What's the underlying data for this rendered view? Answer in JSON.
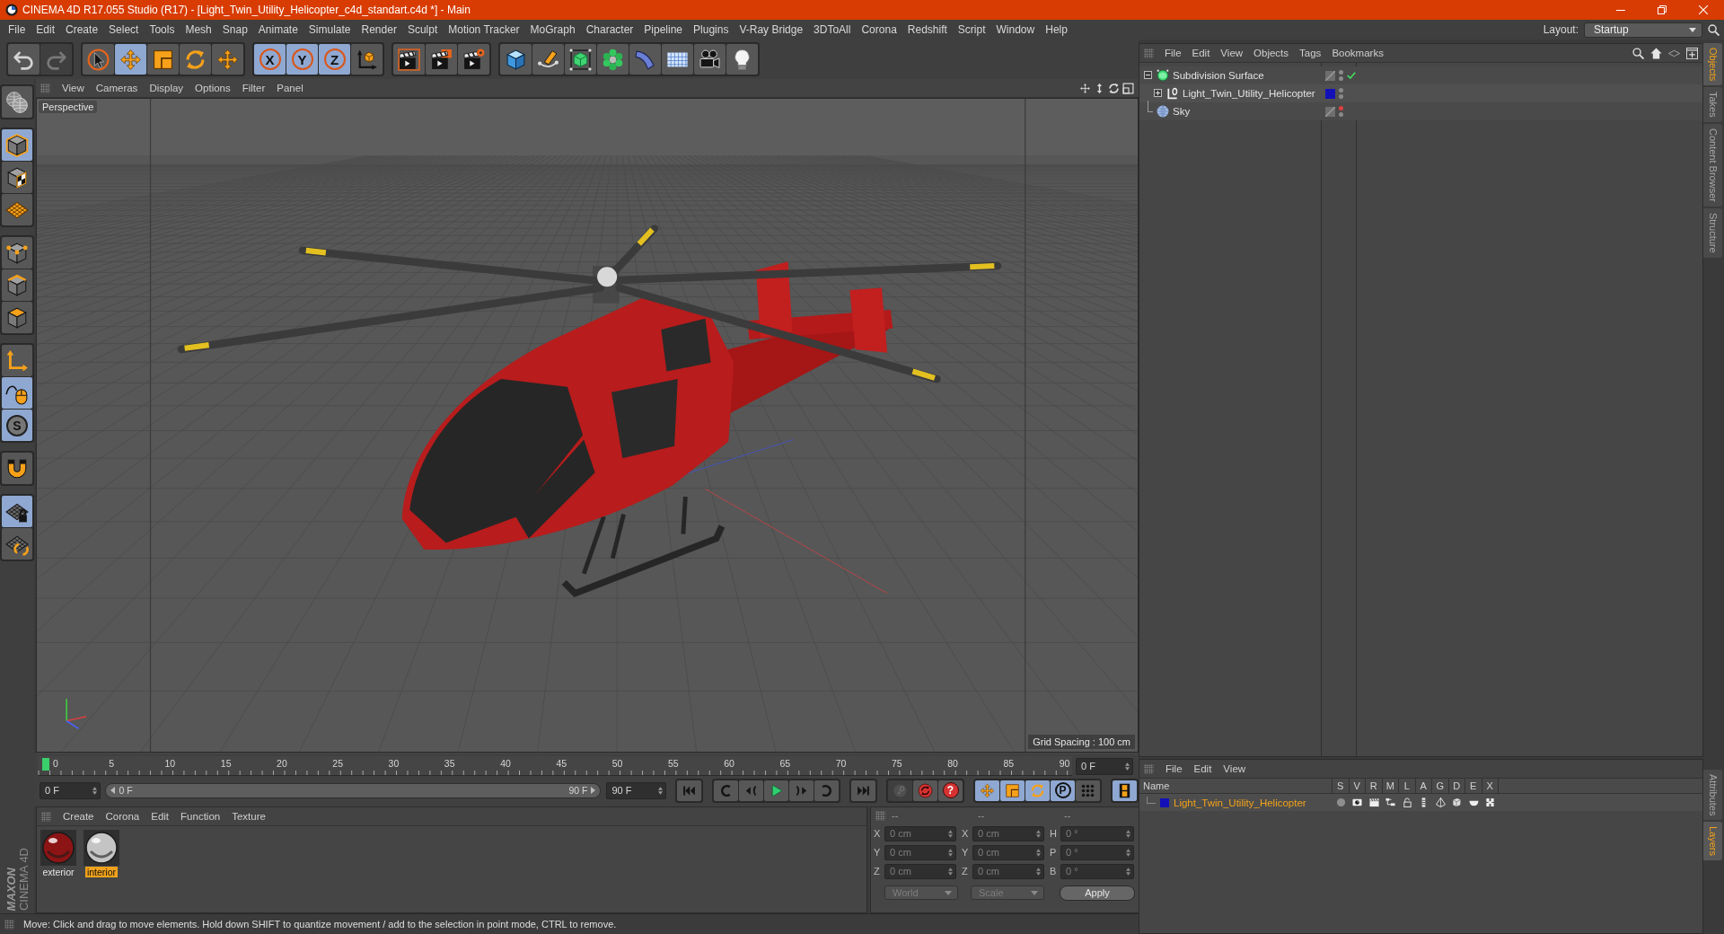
{
  "window": {
    "title": "CINEMA 4D R17.055 Studio (R17) - [Light_Twin_Utility_Helicopter_c4d_standart.c4d *] - Main"
  },
  "menu": [
    "File",
    "Edit",
    "Create",
    "Select",
    "Tools",
    "Mesh",
    "Snap",
    "Animate",
    "Simulate",
    "Render",
    "Sculpt",
    "Motion Tracker",
    "MoGraph",
    "Character",
    "Pipeline",
    "Plugins",
    "V-Ray Bridge",
    "3DToAll",
    "Corona",
    "Redshift",
    "Script",
    "Window",
    "Help"
  ],
  "layout": {
    "label": "Layout:",
    "value": "Startup"
  },
  "toolbar": [
    [
      {
        "kind": "undo",
        "selected": false,
        "disabled": false
      },
      {
        "kind": "redo",
        "selected": false,
        "disabled": true
      }
    ],
    [
      {
        "kind": "live_selection",
        "selected": false,
        "disabled": false
      },
      {
        "kind": "move",
        "selected": true,
        "disabled": false
      },
      {
        "kind": "scale",
        "selected": false,
        "disabled": false
      },
      {
        "kind": "rotate",
        "selected": false,
        "disabled": false
      },
      {
        "kind": "move",
        "selected": false,
        "disabled": false
      }
    ],
    [
      {
        "kind": "axis_lock",
        "label": "X",
        "selected": true,
        "disabled": false
      },
      {
        "kind": "axis_lock",
        "label": "Y",
        "selected": true,
        "disabled": false
      },
      {
        "kind": "axis_lock",
        "label": "Z",
        "selected": true,
        "disabled": false
      },
      {
        "kind": "coord_system",
        "selected": false,
        "disabled": false
      }
    ],
    [
      {
        "kind": "render_view",
        "selected": false,
        "disabled": false
      },
      {
        "kind": "render_picture_viewer",
        "selected": false,
        "disabled": false
      },
      {
        "kind": "render_settings",
        "selected": false,
        "disabled": false
      }
    ],
    [
      {
        "kind": "cube",
        "selected": false,
        "disabled": false
      },
      {
        "kind": "pen",
        "selected": false,
        "disabled": false
      },
      {
        "kind": "subdivision",
        "selected": false,
        "disabled": false
      },
      {
        "kind": "cloner",
        "selected": false,
        "disabled": false
      },
      {
        "kind": "bend",
        "selected": false,
        "disabled": false
      },
      {
        "kind": "floor",
        "selected": false,
        "disabled": false
      },
      {
        "kind": "camera",
        "selected": false,
        "disabled": false
      },
      {
        "kind": "light",
        "selected": false,
        "disabled": false
      }
    ]
  ],
  "left_toolbar": [
    [
      {
        "kind": "make_editable",
        "selected": false
      }
    ],
    [
      {
        "kind": "model",
        "selected": true
      },
      {
        "kind": "texture",
        "selected": false
      },
      {
        "kind": "workplane",
        "selected": false
      }
    ],
    [
      {
        "kind": "points",
        "selected": false
      },
      {
        "kind": "edges",
        "selected": false
      },
      {
        "kind": "polygons",
        "selected": false
      }
    ],
    [
      {
        "kind": "axis",
        "selected": false
      },
      {
        "kind": "tweak",
        "selected": true
      },
      {
        "kind": "snap",
        "label": "S",
        "selected": true
      }
    ],
    [
      {
        "kind": "magnet",
        "selected": false
      }
    ],
    [
      {
        "kind": "workplane_lock",
        "selected": true
      },
      {
        "kind": "workplane_rotate",
        "selected": false
      }
    ]
  ],
  "logo": {
    "brand": "MAXON",
    "product": "CINEMA 4D"
  },
  "viewport": {
    "menu": [
      "View",
      "Cameras",
      "Display",
      "Options",
      "Filter",
      "Panel"
    ],
    "camera": "Perspective",
    "grid_spacing": "Grid Spacing : 100 cm"
  },
  "timeline": {
    "ticks": [
      "0",
      "5",
      "10",
      "15",
      "20",
      "25",
      "30",
      "35",
      "40",
      "45",
      "50",
      "55",
      "60",
      "65",
      "70",
      "75",
      "80",
      "85",
      "90"
    ],
    "playhead": {
      "level": 0
    },
    "current_frame": "0 F",
    "start_field": "0 F",
    "range": {
      "start": "0 F",
      "end": "90 F"
    },
    "end_field": "90 F",
    "transport": [
      [
        {
          "kind": "go_start",
          "selected": false,
          "disabled": false
        }
      ],
      [
        {
          "kind": "prev_key",
          "selected": false,
          "disabled": false
        },
        {
          "kind": "prev_frame",
          "selected": false,
          "disabled": false
        },
        {
          "kind": "play",
          "selected": false,
          "disabled": false
        },
        {
          "kind": "next_frame",
          "selected": false,
          "disabled": false
        },
        {
          "kind": "next_key",
          "selected": false,
          "disabled": false
        }
      ],
      [
        {
          "kind": "go_end",
          "selected": false,
          "disabled": false
        }
      ],
      [
        {
          "kind": "key",
          "selected": false,
          "disabled": true
        },
        {
          "kind": "autokey",
          "selected": false,
          "disabled": false
        },
        {
          "kind": "help",
          "label": "?",
          "selected": false,
          "disabled": false
        }
      ],
      [
        {
          "kind": "move",
          "selected": true,
          "disabled": false
        },
        {
          "kind": "scale",
          "selected": true,
          "disabled": false
        },
        {
          "kind": "rotate",
          "selected": true,
          "disabled": false
        },
        {
          "kind": "parameter",
          "label": "P",
          "selected": true,
          "disabled": false
        },
        {
          "kind": "point_level",
          "selected": false,
          "disabled": false
        }
      ],
      [
        {
          "kind": "timeline",
          "selected": true,
          "disabled": false
        }
      ]
    ]
  },
  "material_manager": {
    "menu": [
      "Create",
      "Corona",
      "Edit",
      "Function",
      "Texture"
    ],
    "materials": [
      {
        "name": "exterior",
        "selected": false,
        "color": "#8c1414"
      },
      {
        "name": "interior",
        "selected": true,
        "color": "#c4c4c4"
      }
    ]
  },
  "coordinates": {
    "disabled": true,
    "headers": [
      "--",
      "--",
      "--"
    ],
    "rows": [
      {
        "cells": [
          {
            "axis": "X",
            "value": "0 cm"
          },
          {
            "axis": "X",
            "value": "0 cm"
          },
          {
            "axis": "H",
            "value": "0 °"
          }
        ]
      },
      {
        "cells": [
          {
            "axis": "Y",
            "value": "0 cm"
          },
          {
            "axis": "Y",
            "value": "0 cm"
          },
          {
            "axis": "P",
            "value": "0 °"
          }
        ]
      },
      {
        "cells": [
          {
            "axis": "Z",
            "value": "0 cm"
          },
          {
            "axis": "Z",
            "value": "0 cm"
          },
          {
            "axis": "B",
            "value": "0 °"
          }
        ]
      }
    ],
    "dropdowns": [
      "World",
      "Scale"
    ],
    "apply": "Apply"
  },
  "status_bar": "Move: Click and drag to move elements. Hold down SHIFT to quantize movement / add to the selection in point mode, CTRL to remove.",
  "object_manager": {
    "menu": [
      "File",
      "Edit",
      "View",
      "Objects",
      "Tags",
      "Bookmarks"
    ],
    "objects": [
      {
        "name": "Subdivision Surface",
        "kind": "subdivision",
        "expanded": true,
        "selected": false,
        "checked": true,
        "hidden_in_editor": false,
        "children": [
          {
            "name": "Light_Twin_Utility_Helicopter",
            "kind": "null",
            "expanded": false,
            "selected": false,
            "checked": false,
            "hidden_in_editor": false,
            "color": "#1410b8"
          }
        ]
      },
      {
        "name": "Sky",
        "kind": "sky",
        "selected": false,
        "checked": false,
        "hidden_in_editor": true
      }
    ]
  },
  "layer_manager": {
    "menu": [
      "File",
      "Edit",
      "View"
    ],
    "columns": [
      "Name",
      "S",
      "V",
      "R",
      "M",
      "L",
      "A",
      "G",
      "D",
      "E",
      "X"
    ],
    "layers": [
      {
        "name": "Light_Twin_Utility_Helicopter",
        "selected": true,
        "color": "#1410b8",
        "toggles": [
          {
            "kind": "solo"
          },
          {
            "kind": "view"
          },
          {
            "kind": "render"
          },
          {
            "kind": "manager"
          },
          {
            "kind": "lock"
          },
          {
            "kind": "animation"
          },
          {
            "kind": "generators"
          },
          {
            "kind": "deformers"
          },
          {
            "kind": "expressions"
          },
          {
            "kind": "xref"
          }
        ]
      }
    ]
  },
  "side_tabs": {
    "top": [
      {
        "label": "Objects",
        "selected": true
      },
      {
        "label": "Takes",
        "selected": false
      },
      {
        "label": "Content Browser",
        "selected": false
      },
      {
        "label": "Structure",
        "selected": false
      }
    ],
    "bottom": [
      {
        "label": "Attributes",
        "selected": false
      },
      {
        "label": "Layers",
        "selected": true
      }
    ]
  }
}
